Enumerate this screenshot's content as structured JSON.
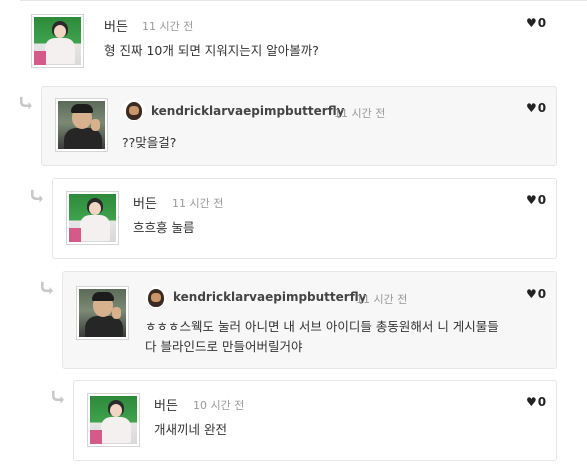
{
  "comments": [
    {
      "author": "버든",
      "time": "11 시간 전",
      "likes": "0",
      "text": "형 진짜 10개 되면 지워지는지 알아볼까?",
      "avatar_icon": "woman-avatar"
    },
    {
      "author": "kendricklarvaepimpbutterfly",
      "time": "11 시간 전",
      "likes": "0",
      "text": "??맞을걸?",
      "avatar_icon": "man-avatar",
      "badge_icon": "bearded-face-icon"
    },
    {
      "author": "버든",
      "time": "11 시간 전",
      "likes": "0",
      "text": "흐흐흥 눌름",
      "avatar_icon": "woman-avatar"
    },
    {
      "author": "kendricklarvaepimpbutterfly",
      "time": "11 시간 전",
      "likes": "0",
      "text_line1": "ㅎㅎㅎ스웩도 눌러 아니면 내 서브 아이디들 총동원해서 니 게시물들",
      "text_line2": "다 블라인드로 만들어버릴거야",
      "avatar_icon": "man-avatar",
      "badge_icon": "bearded-face-icon"
    },
    {
      "author": "버든",
      "time": "10 시간 전",
      "likes": "0",
      "text": "개새끼네 완전",
      "avatar_icon": "woman-avatar"
    }
  ],
  "colors": {
    "alt_background": "#f7f7f7",
    "border": "#e6e6e6",
    "muted_text": "#9a9a9a",
    "arrow": "#c8c8c8"
  }
}
